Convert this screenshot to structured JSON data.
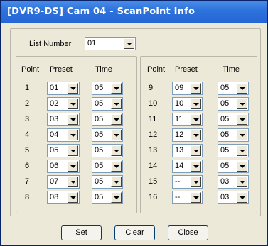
{
  "window": {
    "title": "[DVR9-DS] Cam 04 - ScanPoint Info"
  },
  "list_number": {
    "label": "List Number",
    "value": "01"
  },
  "columns": {
    "point": "Point",
    "preset": "Preset",
    "time": "Time"
  },
  "left_points": [
    {
      "point": "1",
      "preset": "01",
      "time": "05"
    },
    {
      "point": "2",
      "preset": "02",
      "time": "05"
    },
    {
      "point": "3",
      "preset": "03",
      "time": "05"
    },
    {
      "point": "4",
      "preset": "04",
      "time": "05"
    },
    {
      "point": "5",
      "preset": "05",
      "time": "05"
    },
    {
      "point": "6",
      "preset": "06",
      "time": "05"
    },
    {
      "point": "7",
      "preset": "07",
      "time": "05"
    },
    {
      "point": "8",
      "preset": "08",
      "time": "05"
    }
  ],
  "right_points": [
    {
      "point": "9",
      "preset": "09",
      "time": "05"
    },
    {
      "point": "10",
      "preset": "10",
      "time": "05"
    },
    {
      "point": "11",
      "preset": "11",
      "time": "05"
    },
    {
      "point": "12",
      "preset": "12",
      "time": "05"
    },
    {
      "point": "13",
      "preset": "13",
      "time": "05"
    },
    {
      "point": "14",
      "preset": "14",
      "time": "05"
    },
    {
      "point": "15",
      "preset": "--",
      "time": "03"
    },
    {
      "point": "16",
      "preset": "--",
      "time": "03"
    }
  ],
  "buttons": {
    "set": "Set",
    "clear": "Clear",
    "close": "Close"
  }
}
